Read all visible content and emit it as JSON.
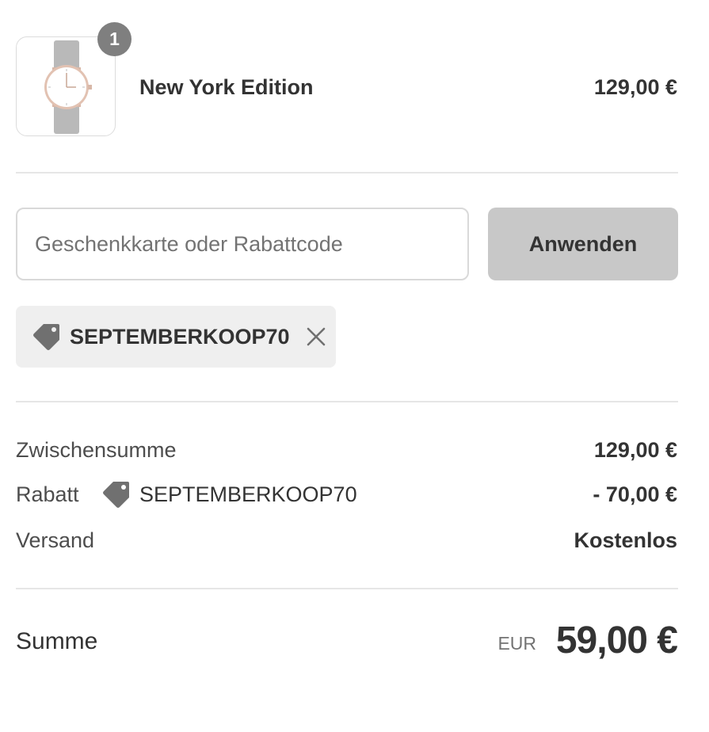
{
  "cart": {
    "item": {
      "quantity": "1",
      "name": "New York Edition",
      "price": "129,00 €",
      "image_icon": "watch-image"
    }
  },
  "discount_form": {
    "placeholder": "Geschenkkarte oder Rabattcode",
    "value": "",
    "apply_label": "Anwenden"
  },
  "applied_code": {
    "code": "SEPTEMBERKOOP70",
    "tag_icon": "tag-icon",
    "remove_icon": "close-icon"
  },
  "summary": {
    "subtotal_label": "Zwischensumme",
    "subtotal_value": "129,00 €",
    "discount_label": "Rabatt",
    "discount_code": "SEPTEMBERKOOP70",
    "discount_value": "- 70,00 €",
    "shipping_label": "Versand",
    "shipping_value": "Kostenlos"
  },
  "total": {
    "label": "Summe",
    "currency": "EUR",
    "amount": "59,00 €"
  },
  "colors": {
    "badge": "#7f7f7f",
    "button_bg": "#c8c8c8",
    "chip_bg": "#efefef",
    "tag_icon": "#707070",
    "divider": "#e6e6e6"
  }
}
